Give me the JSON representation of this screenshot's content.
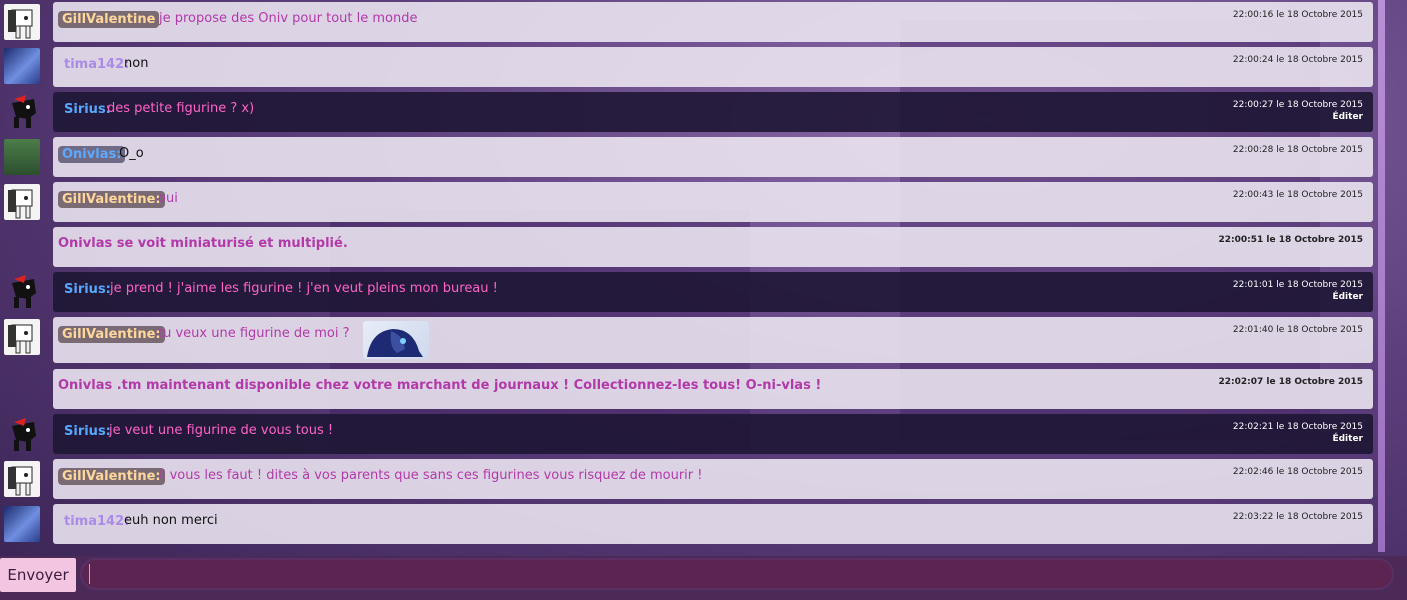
{
  "messages": [
    {
      "type": "user",
      "author": "GillValentine",
      "avatar": "pony-white-icon",
      "text": "je propose des Oniv pour tout le monde",
      "time": "22:00:16 le 18 Octobre 2015"
    },
    {
      "type": "user",
      "author": "tima142:",
      "avatar": "night-sky-icon",
      "text": "non",
      "time": "22:00:24 le 18 Octobre 2015"
    },
    {
      "type": "user-dark",
      "author": "Sirius:",
      "avatar": "pony-black-icon",
      "text": "des petite figurine ? x)",
      "time": "22:00:27 le 18 Octobre 2015",
      "edit": "Éditer"
    },
    {
      "type": "user",
      "author": "Onivlas:",
      "avatar": "pony-green-icon",
      "text": "O_o",
      "time": "22:00:28 le 18 Octobre 2015"
    },
    {
      "type": "user",
      "author": "GillValentine:",
      "avatar": "pony-white-icon",
      "text": "oui",
      "time": "22:00:43 le 18 Octobre 2015"
    },
    {
      "type": "system",
      "text": "Onivlas se voit miniaturisé et multiplié.",
      "time": "22:00:51 le 18 Octobre 2015"
    },
    {
      "type": "user-dark",
      "author": "Sirius:",
      "avatar": "pony-black-icon",
      "text": "je prend ! j'aime les figurine ! j'en veut pleins mon bureau !",
      "time": "22:01:01 le 18 Octobre 2015",
      "edit": "Éditer"
    },
    {
      "type": "user",
      "author": "GillValentine:",
      "avatar": "pony-white-icon",
      "text": "tu veux une figurine de moi ?",
      "time": "22:01:40 le 18 Octobre 2015",
      "emote": "luna-emote"
    },
    {
      "type": "system",
      "text": "Onivlas .tm maintenant disponible chez votre marchant de journaux ! Collectionnez-les tous! O-ni-vlas !",
      "time": "22:02:07 le 18 Octobre 2015"
    },
    {
      "type": "user-dark",
      "author": "Sirius:",
      "avatar": "pony-black-icon",
      "text": "je veut une figurine de vous tous !",
      "time": "22:02:21 le 18 Octobre 2015",
      "edit": "Éditer"
    },
    {
      "type": "user",
      "author": "GillValentine:",
      "avatar": "pony-white-icon",
      "text": "Il vous les faut ! dites à vos parents que sans ces figurines vous risquez de mourir !",
      "time": "22:02:46 le 18 Octobre 2015"
    },
    {
      "type": "user",
      "author": "tima142:",
      "avatar": "night-sky-icon",
      "text": "euh non merci",
      "time": "22:03:22 le 18 Octobre 2015"
    }
  ],
  "input": {
    "send_label": "Envoyer",
    "value": "",
    "placeholder": ""
  }
}
